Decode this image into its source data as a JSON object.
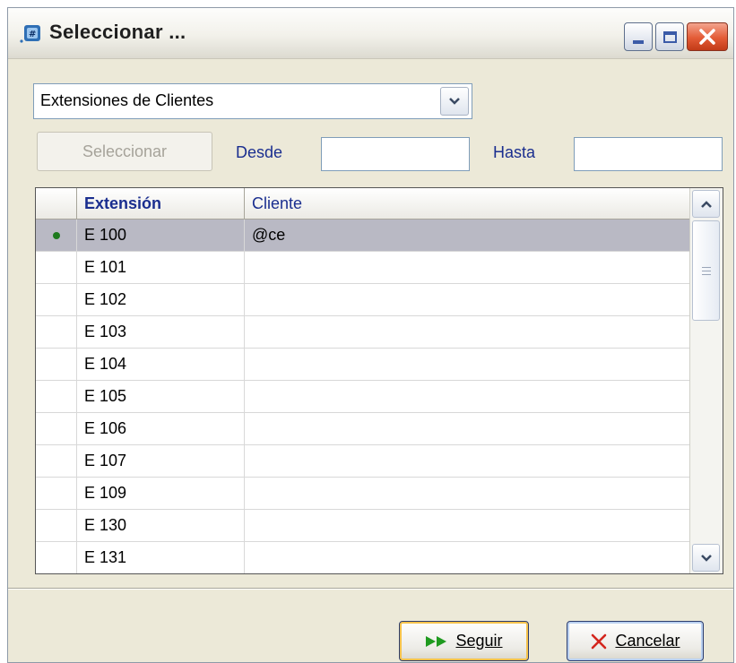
{
  "window": {
    "title": "Seleccionar ..."
  },
  "filter": {
    "combo_value": "Extensiones de Clientes",
    "select_button": "Seleccionar",
    "desde_label": "Desde",
    "desde_value": "",
    "hasta_label": "Hasta",
    "hasta_value": ""
  },
  "grid": {
    "columns": [
      "Extensión",
      "Cliente"
    ],
    "rows": [
      {
        "ext": "E 100",
        "cliente": "@ce",
        "selected": true
      },
      {
        "ext": "E 101",
        "cliente": ""
      },
      {
        "ext": "E 102",
        "cliente": ""
      },
      {
        "ext": "E 103",
        "cliente": ""
      },
      {
        "ext": "E 104",
        "cliente": ""
      },
      {
        "ext": "E 105",
        "cliente": ""
      },
      {
        "ext": "E 106",
        "cliente": ""
      },
      {
        "ext": "E 107",
        "cliente": ""
      },
      {
        "ext": "E 109",
        "cliente": ""
      },
      {
        "ext": "E 130",
        "cliente": ""
      },
      {
        "ext": "E 131",
        "cliente": ""
      }
    ]
  },
  "footer": {
    "seguir_label": "Seguir",
    "cancelar_label": "Cancelar"
  },
  "colors": {
    "label_blue": "#1a2e8f",
    "selected_row": "#b9b9c4",
    "indicator_green": "#1e7a1e",
    "close_red": "#e35b36"
  }
}
